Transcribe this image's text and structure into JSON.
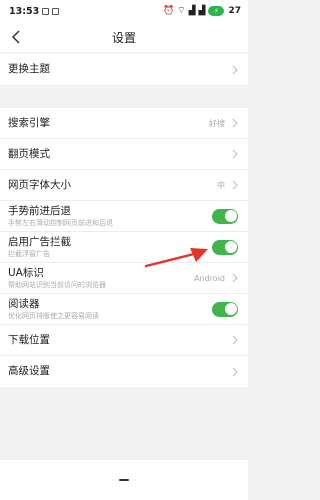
{
  "status": {
    "time": "13:53",
    "battery": "27"
  },
  "header": {
    "title": "设置"
  },
  "groups": {
    "theme": {
      "label": "更换主题"
    },
    "search_engine": {
      "label": "搜索引擎",
      "value": "好搜"
    },
    "page_turn": {
      "label": "翻页模式"
    },
    "font_size": {
      "label": "网页字体大小",
      "value": "中"
    },
    "gesture": {
      "label": "手势前进后退",
      "sub": "手势左右滑动控制网页前进和后退",
      "enabled": true
    },
    "adblock": {
      "label": "启用广告拦截",
      "sub": "拦截浮窗广告",
      "enabled": true
    },
    "ua": {
      "label": "UA标识",
      "sub": "帮助网站识别当前访问的浏览器",
      "value": "Android"
    },
    "reader": {
      "label": "阅读器",
      "sub": "优化网页排版使之更容易阅读",
      "enabled": true
    },
    "download": {
      "label": "下载位置"
    },
    "advanced": {
      "label": "高级设置"
    }
  },
  "colors": {
    "toggle_on": "#3fb54b",
    "annotation_arrow": "#e5332a",
    "battery": "#29b54a"
  }
}
